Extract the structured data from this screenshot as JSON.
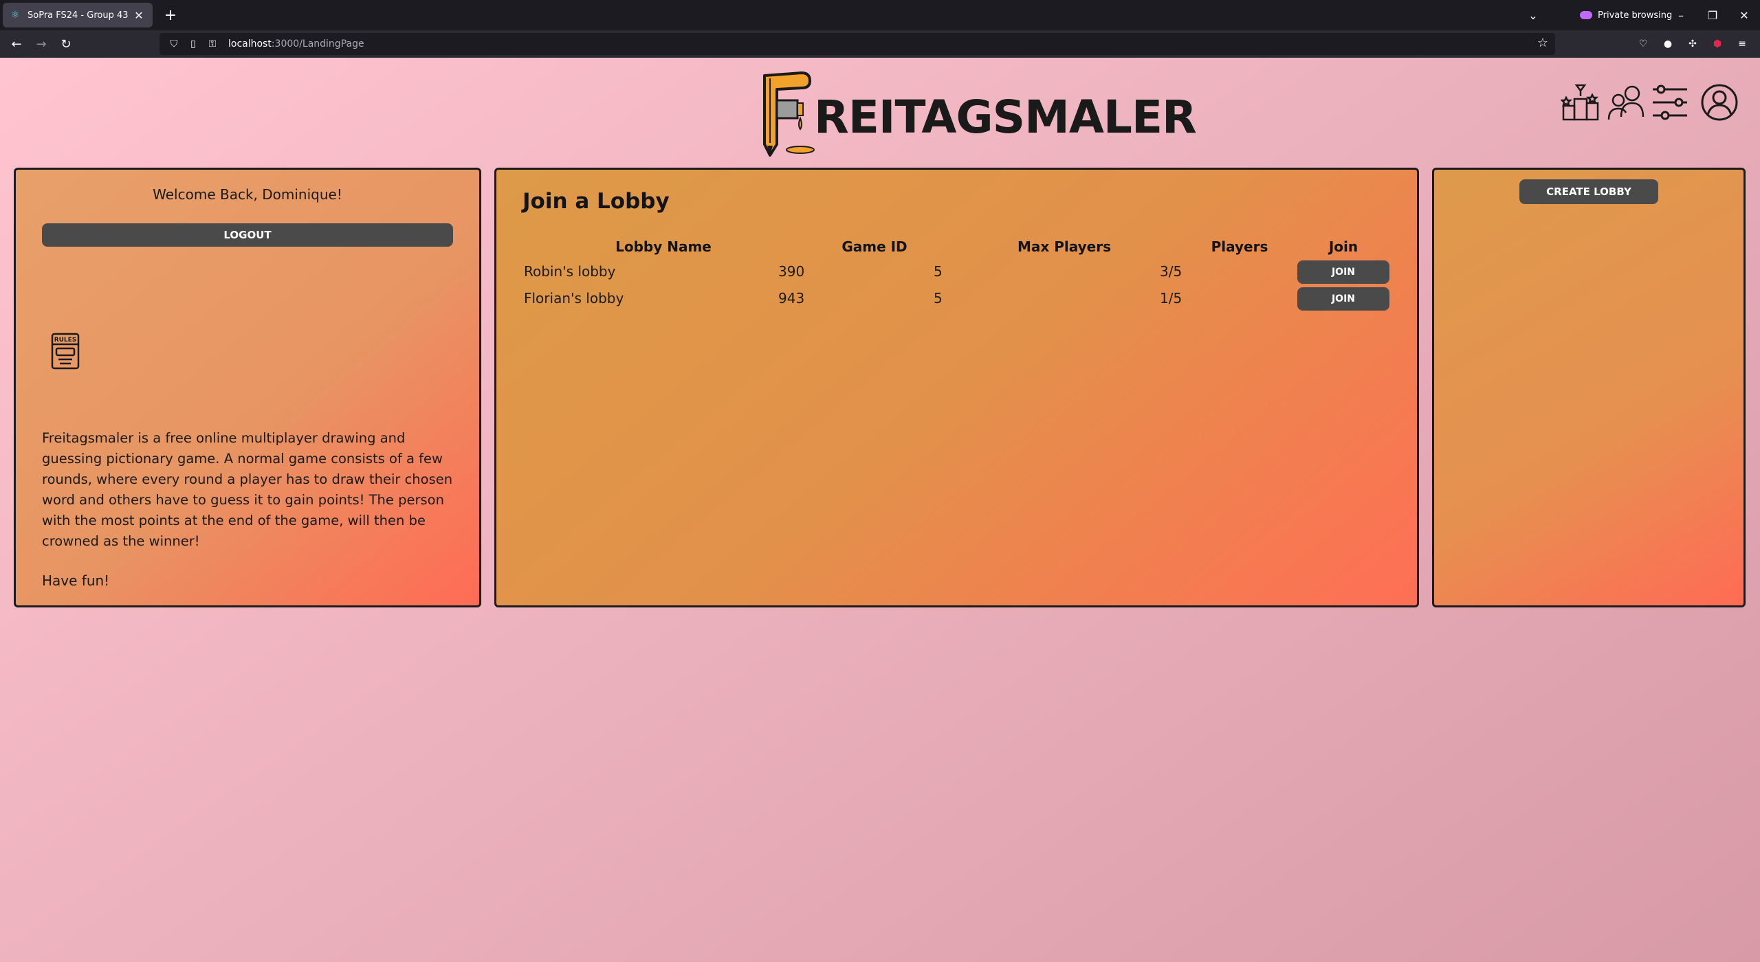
{
  "browser": {
    "tab_title": "SoPra FS24 - Group 43",
    "private_label": "Private browsing",
    "url_host": "localhost",
    "url_path": ":3000/LandingPage"
  },
  "header": {
    "logo_text": "REITAGSMALER"
  },
  "welcome": {
    "greeting": "Welcome Back, Dominique!",
    "logout_label": "LOGOUT",
    "rules_icon_text": "RULES",
    "description": "Freitagsmaler is a free online multiplayer drawing and guessing pictionary game. A normal game consists of a few rounds, where every round a player has to draw their chosen word and others have to guess it to gain points! The person with the most points at the end of the game, will then be crowned as the winner!",
    "closing": "Have fun!"
  },
  "lobbies": {
    "title": "Join a Lobby",
    "columns": [
      "Lobby Name",
      "Game ID",
      "Max Players",
      "Players",
      "Join"
    ],
    "rows": [
      {
        "name": "Robin's lobby",
        "game_id": "390",
        "max_players": "5",
        "players": "3/5",
        "join_label": "JOIN"
      },
      {
        "name": "Florian's lobby",
        "game_id": "943",
        "max_players": "5",
        "players": "1/5",
        "join_label": "JOIN"
      }
    ]
  },
  "create": {
    "label": "CREATE LOBBY"
  }
}
